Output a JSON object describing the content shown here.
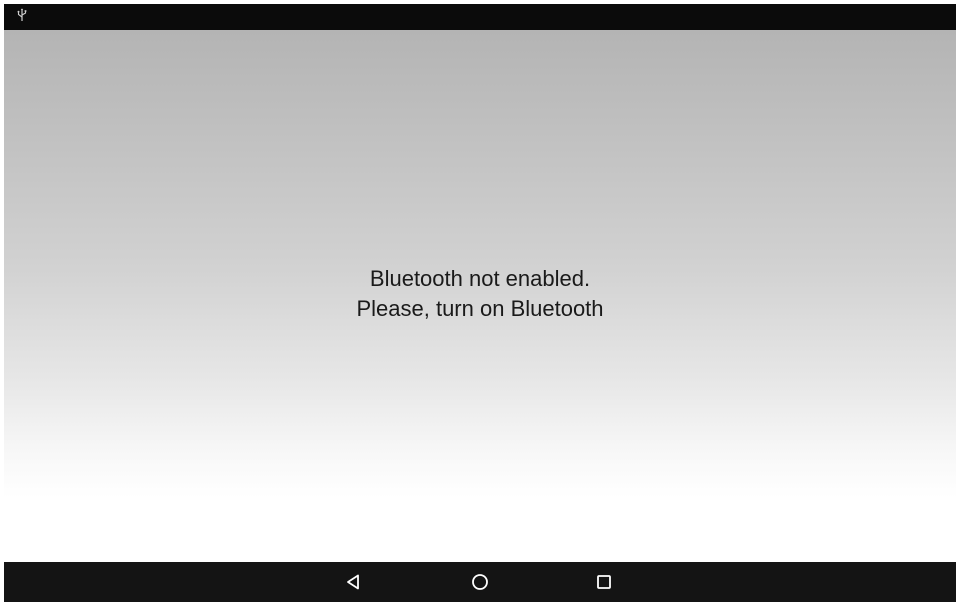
{
  "status_bar": {
    "icons": [
      "usb-icon"
    ]
  },
  "message": {
    "line1": "Bluetooth not enabled.",
    "line2": "Please, turn on Bluetooth"
  },
  "nav_bar": {
    "buttons": [
      "back-icon",
      "home-icon",
      "recents-icon"
    ]
  },
  "colors": {
    "status_bar_bg": "#0b0b0b",
    "nav_bar_bg": "#141414",
    "text": "#1a1a1a",
    "nav_icon": "#ffffff"
  }
}
